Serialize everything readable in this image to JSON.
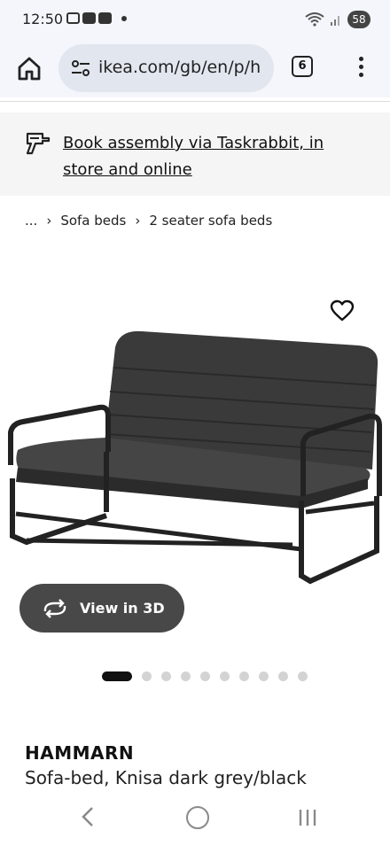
{
  "status_bar": {
    "time": "12:50",
    "battery": "58"
  },
  "browser": {
    "url": "ikea.com/gb/en/p/h",
    "tab_count": "6"
  },
  "assembly_banner": {
    "text": "Book assembly via Taskrabbit, in store and online"
  },
  "breadcrumb": {
    "ellipsis": "...",
    "separator": "›",
    "items": [
      "Sofa beds",
      "2 seater sofa beds"
    ]
  },
  "product": {
    "view3d_label": "View in 3D",
    "name": "HAMMARN",
    "description": "Sofa-bed, Knisa dark grey/black",
    "carousel": {
      "count": 10,
      "active_index": 0
    }
  },
  "colors": {
    "accent_dark": "#484848",
    "banner_bg": "#f5f5f5",
    "browser_bg": "#f4f6fb"
  }
}
